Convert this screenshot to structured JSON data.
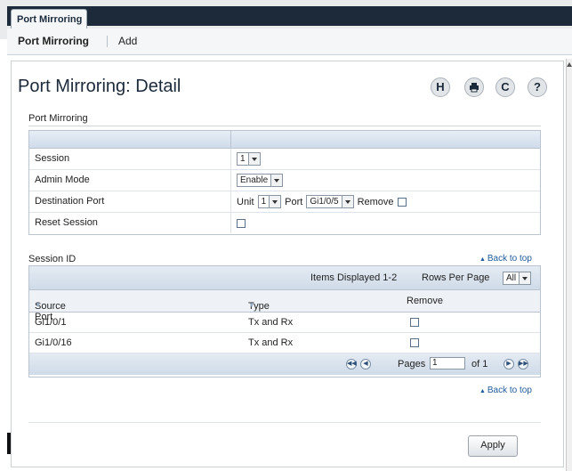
{
  "top_tab": "Port Mirroring",
  "subnav": {
    "active": "Port Mirroring",
    "add": "Add"
  },
  "page_title": "Port Mirroring: Detail",
  "tools": {
    "save_icon": "H",
    "print_icon": "print",
    "refresh_icon": "C",
    "help_icon": "?"
  },
  "section1": {
    "title": "Port Mirroring",
    "rows": {
      "session_label": "Session",
      "session_value": "1",
      "admin_mode_label": "Admin Mode",
      "admin_mode_value": "Enable",
      "dest_port_label": "Destination Port",
      "unit_label": "Unit",
      "unit_value": "1",
      "port_label": "Port",
      "port_value": "Gi1/0/5",
      "remove_label": "Remove",
      "reset_label": "Reset Session"
    }
  },
  "section2": {
    "title": "Session ID",
    "back_to_top": "Back to top",
    "items_displayed": "Items Displayed 1-2",
    "rows_per_page_label": "Rows Per Page",
    "rows_per_page_value": "All",
    "columns": {
      "source_port": "Source Port",
      "type": "Type",
      "remove": "Remove"
    },
    "rows": [
      {
        "source_port": "Gi1/0/1",
        "type": "Tx and Rx"
      },
      {
        "source_port": "Gi1/0/16",
        "type": "Tx and Rx"
      }
    ],
    "pages_label": "Pages",
    "page_value": "1",
    "of_label": "of 1",
    "back_to_top_bottom": "Back to top"
  },
  "apply_label": "Apply",
  "colors": {
    "header_dark": "#1c2a3a",
    "link": "#1f5b9c",
    "panel_head": "#cfdceb"
  }
}
